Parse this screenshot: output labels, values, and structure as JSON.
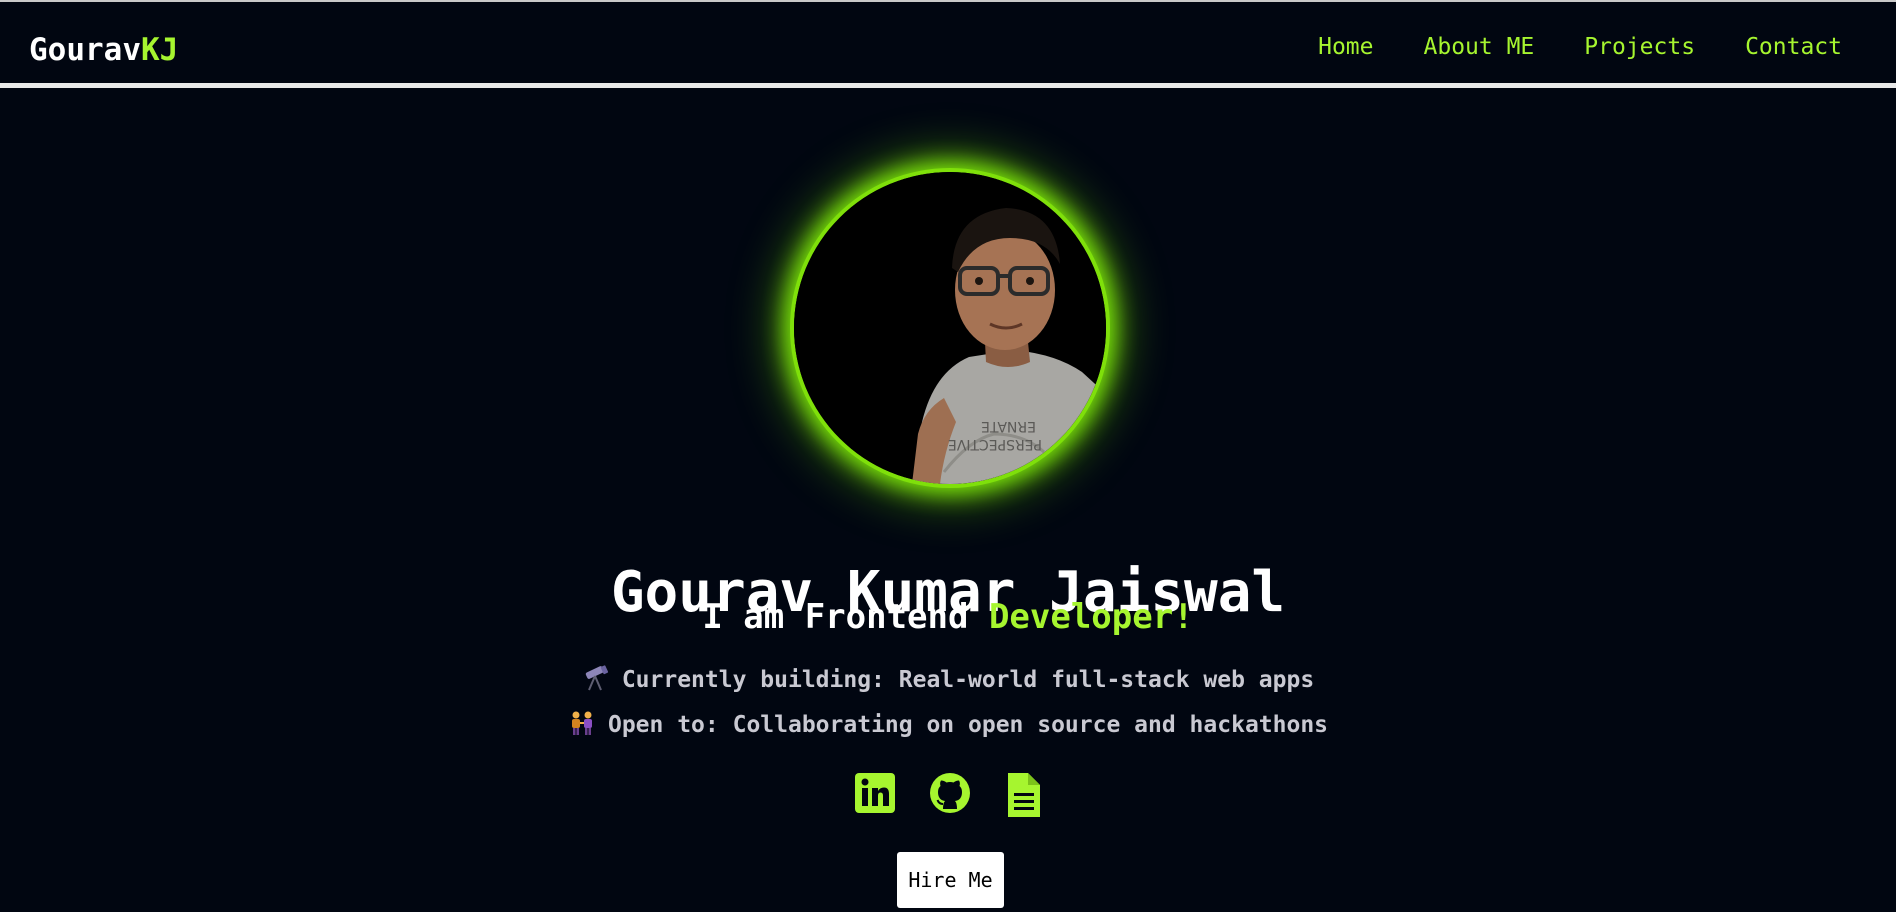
{
  "brand": {
    "part1": "Gourav",
    "part2": "KJ"
  },
  "nav": {
    "items": [
      {
        "label": "Home"
      },
      {
        "label": "About ME"
      },
      {
        "label": "Projects"
      },
      {
        "label": "Contact"
      }
    ]
  },
  "hero": {
    "name": "Gourav Kumar Jaiswal",
    "role_prefix": "I am Frontend ",
    "role_highlight": "Developer!",
    "info": [
      {
        "icon": "telescope-icon",
        "text": "Currently building: Real-world full-stack web apps"
      },
      {
        "icon": "people-holding-hands-icon",
        "text": "Open to: Collaborating on open source and hackathons"
      }
    ],
    "socials": [
      {
        "icon": "linkedin-icon"
      },
      {
        "icon": "github-icon"
      },
      {
        "icon": "resume-document-icon"
      }
    ],
    "hire_label": "Hire Me"
  },
  "colors": {
    "background": "#010611",
    "accent": "#a6f52f",
    "text": "#ffffff",
    "muted_text": "#c9c9d2",
    "nav_border": "#e9e9e9"
  }
}
